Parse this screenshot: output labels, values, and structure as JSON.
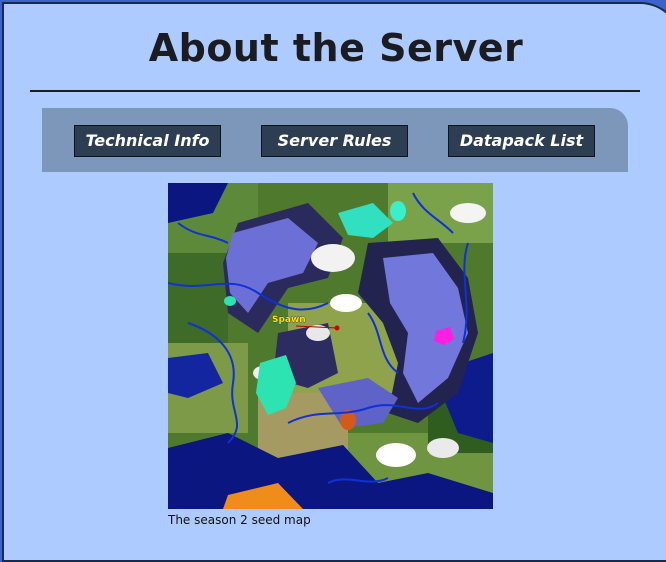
{
  "page": {
    "title": "About the Server"
  },
  "nav": {
    "buttons": [
      {
        "label": "Technical Info"
      },
      {
        "label": "Server Rules"
      },
      {
        "label": "Datapack List"
      }
    ]
  },
  "map": {
    "spawn_label": "Spawn",
    "caption": "The season 2 seed map"
  },
  "colors": {
    "page_background": "#aecbff",
    "outer_background": "#3b63c9",
    "nav_bar": "#7d97bb",
    "nav_button": "#2d3d52",
    "spawn_label": "#ffe600"
  }
}
